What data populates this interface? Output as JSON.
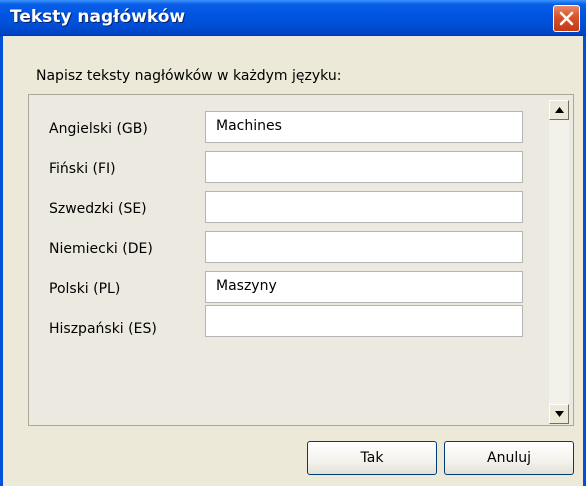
{
  "window": {
    "title": "Teksty nagłówków"
  },
  "instruction": "Napisz teksty nagłówków w każdym języku:",
  "rows": [
    {
      "label": "Angielski (GB)",
      "value": "Machines"
    },
    {
      "label": "Fiński (FI)",
      "value": ""
    },
    {
      "label": "Szwedzki (SE)",
      "value": ""
    },
    {
      "label": "Niemiecki (DE)",
      "value": ""
    },
    {
      "label": "Polski (PL)",
      "value": "Maszyny"
    },
    {
      "label": "Hiszpański (ES)",
      "value": ""
    }
  ],
  "buttons": {
    "ok": "Tak",
    "cancel": "Anuluj"
  },
  "icons": {
    "close": "close-icon",
    "scroll_up": "arrow-up-icon",
    "scroll_down": "arrow-down-icon"
  },
  "colors": {
    "titlebar": "#0054e3",
    "close_button": "#d9552c",
    "dialog_bg": "#ece9d8"
  }
}
